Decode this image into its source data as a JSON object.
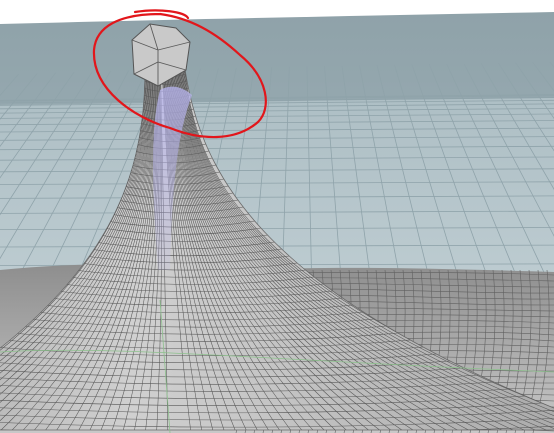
{
  "viewport": {
    "background": "#ffffff",
    "sky_color": "#90a4ab",
    "ground_color": "#c3d0d5",
    "grid_line_color": "#8fa3aa",
    "mesh_fill_color": "#bcbcbc",
    "mesh_wire_color": "#5a5a5a",
    "highlight_color": "#a9a7e6",
    "annotation_color": "#e2161b",
    "axis_line_color": "#8cc08c"
  },
  "scene": {
    "object": "mesh-peak",
    "annotation_shape": "freehand-circle"
  }
}
